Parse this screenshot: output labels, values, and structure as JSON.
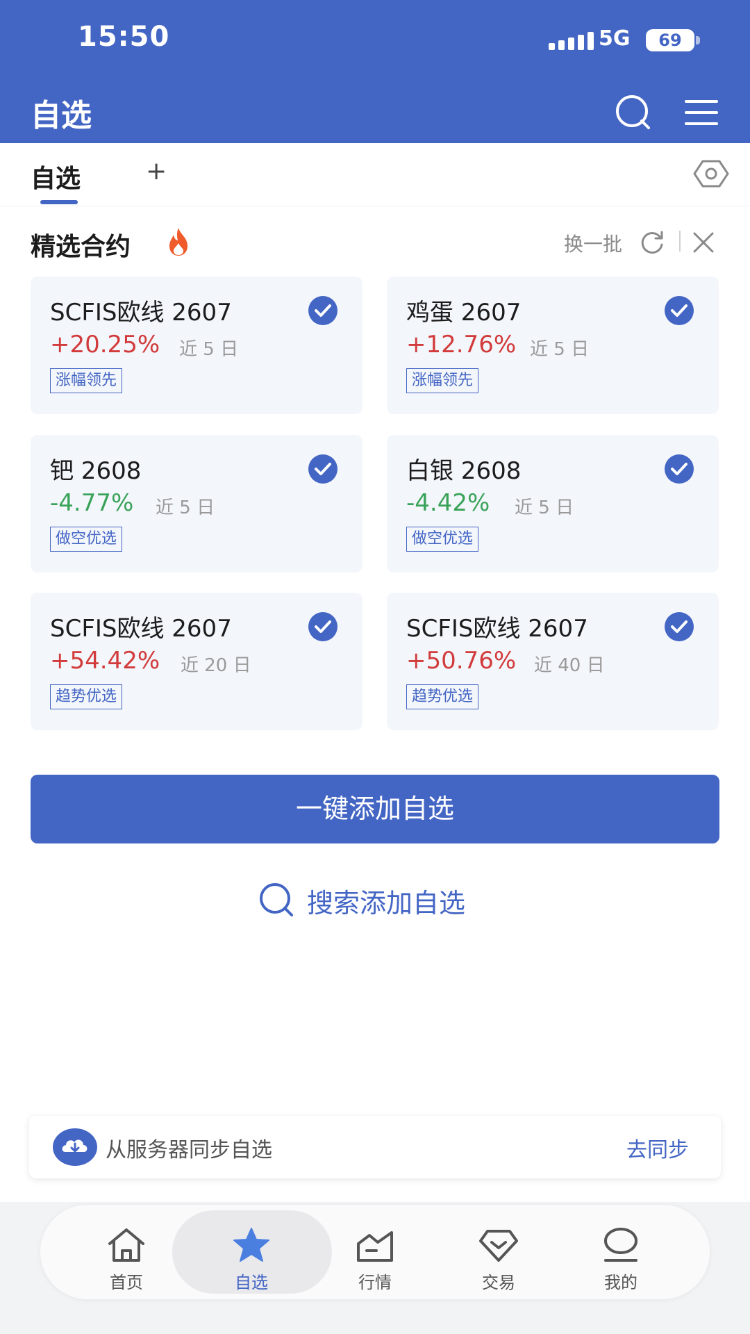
{
  "status_bar": {
    "time": "15:50",
    "network": "5G",
    "battery": "69"
  },
  "header": {
    "title": "自选"
  },
  "tabs": {
    "active": "自选",
    "add": "+"
  },
  "section": {
    "title": "精选合约",
    "refresh_label": "换一批"
  },
  "cards": [
    {
      "name": "SCFIS欧线 2607",
      "change": "+20.25%",
      "direction": "up",
      "period": "近 5 日",
      "tag": "涨幅领先",
      "checked": true
    },
    {
      "name": "鸡蛋 2607",
      "change": "+12.76%",
      "direction": "up",
      "period": "近 5 日",
      "tag": "涨幅领先",
      "checked": true
    },
    {
      "name": "钯 2608",
      "change": "-4.77%",
      "direction": "down",
      "period": "近 5 日",
      "tag": "做空优选",
      "checked": true
    },
    {
      "name": "白银 2608",
      "change": "-4.42%",
      "direction": "down",
      "period": "近 5 日",
      "tag": "做空优选",
      "checked": true
    },
    {
      "name": "SCFIS欧线 2607",
      "change": "+54.42%",
      "direction": "up",
      "period": "近 20 日",
      "tag": "趋势优选",
      "checked": true
    },
    {
      "name": "SCFIS欧线 2607",
      "change": "+50.76%",
      "direction": "up",
      "period": "近 40 日",
      "tag": "趋势优选",
      "checked": true
    }
  ],
  "actions": {
    "add_all": "一键添加自选",
    "search_add": "搜索添加自选"
  },
  "sync": {
    "text": "从服务器同步自选",
    "link": "去同步"
  },
  "nav": [
    {
      "label": "首页",
      "icon": "home-icon",
      "active": false
    },
    {
      "label": "自选",
      "icon": "star-icon",
      "active": true
    },
    {
      "label": "行情",
      "icon": "chart-icon",
      "active": false
    },
    {
      "label": "交易",
      "icon": "diamond-icon",
      "active": false
    },
    {
      "label": "我的",
      "icon": "profile-icon",
      "active": false
    }
  ],
  "colors": {
    "primary": "#4365c4",
    "up": "#d23b3b",
    "down": "#3aa35a",
    "card_bg": "#f3f6fb"
  }
}
